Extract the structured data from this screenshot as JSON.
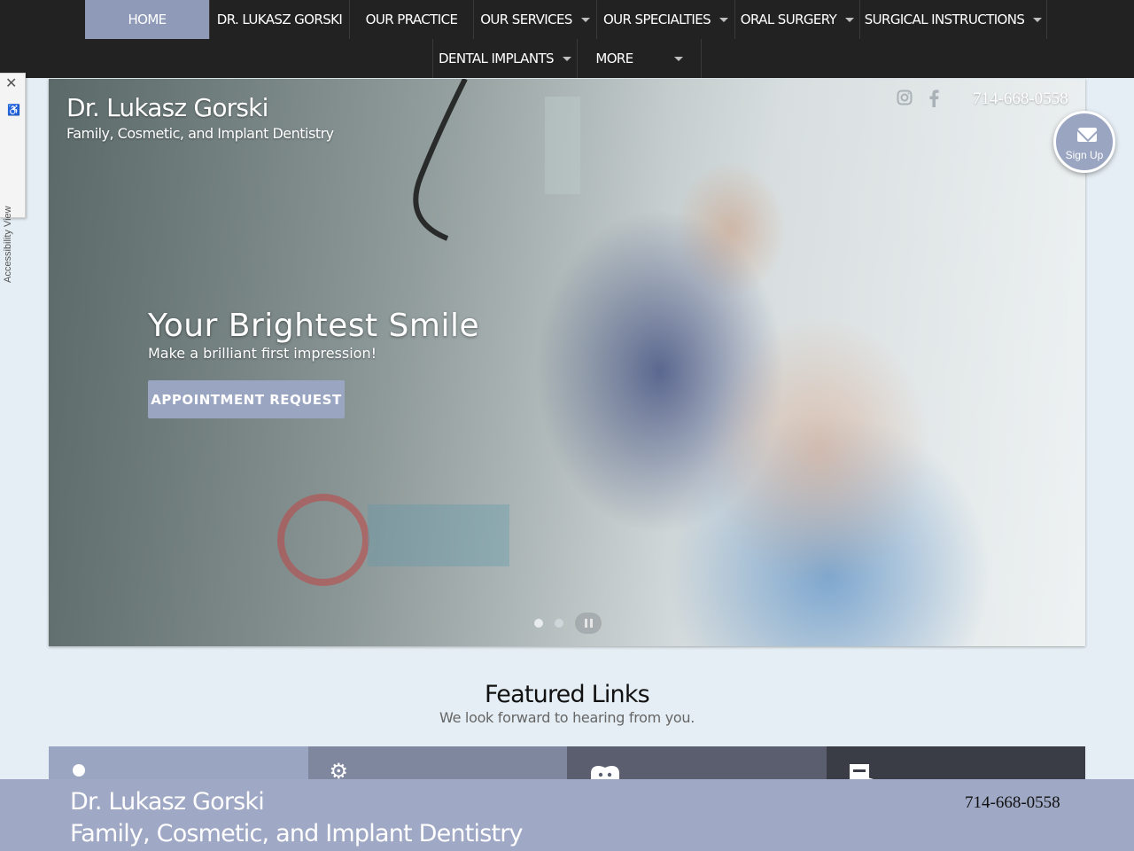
{
  "nav": {
    "row1": [
      {
        "label": "HOME",
        "active": true,
        "dropdown": false
      },
      {
        "label": "DR. LUKASZ GORSKI",
        "dropdown": false
      },
      {
        "label": "OUR PRACTICE",
        "dropdown": false
      },
      {
        "label": "OUR SERVICES",
        "dropdown": true
      },
      {
        "label": "OUR SPECIALTIES",
        "dropdown": true
      },
      {
        "label": "ORAL SURGERY",
        "dropdown": true
      },
      {
        "label": "SURGICAL INSTRUCTIONS",
        "dropdown": true
      }
    ],
    "row2": [
      {
        "label": "DENTAL IMPLANTS",
        "dropdown": true
      },
      {
        "label": "MORE",
        "dropdown": true
      }
    ]
  },
  "accessibility": {
    "label": "Accessibility View",
    "close": "✕"
  },
  "hero": {
    "brand_title": "Dr. Lukasz Gorski",
    "brand_sub": "Family, Cosmetic, and Implant Dentistry",
    "phone": "714-668-0558",
    "social_icons": [
      "instagram-icon",
      "facebook-icon"
    ],
    "slide": {
      "title": "Your Brightest Smile",
      "subtitle": "Make a brilliant first impression!",
      "button": "APPOINTMENT REQUEST"
    },
    "slide_count": 2,
    "active_slide": 1
  },
  "signup": {
    "label": "Sign Up"
  },
  "featured": {
    "title": "Featured Links",
    "subtitle": "We look forward to hearing from you.",
    "tiles": [
      {
        "icon": "person-icon",
        "color": "#9aa5c1"
      },
      {
        "icon": "gear-icon",
        "color": "#7f879f"
      },
      {
        "icon": "tooth-icon",
        "color": "#5a5e6e"
      },
      {
        "icon": "form-icon",
        "color": "#3a3d46"
      }
    ]
  },
  "footer": {
    "title": "Dr. Lukasz Gorski",
    "subtitle": "Family, Cosmetic, and Implant Dentistry",
    "phone": "714-668-0558"
  },
  "colors": {
    "accent": "#9aa5c1",
    "nav_bg": "#222222",
    "page_bg": "#e5eef4"
  }
}
